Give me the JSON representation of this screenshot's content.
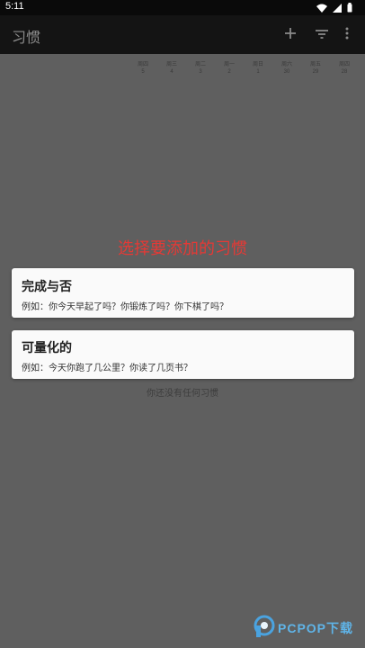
{
  "status": {
    "time": "5:11"
  },
  "appbar": {
    "title": "习惯",
    "icons": [
      "plus-icon",
      "filter-icon",
      "more-vert-icon"
    ]
  },
  "days": [
    {
      "name": "周四",
      "num": "5"
    },
    {
      "name": "周三",
      "num": "4"
    },
    {
      "name": "周二",
      "num": "3"
    },
    {
      "name": "周一",
      "num": "2"
    },
    {
      "name": "周日",
      "num": "1"
    },
    {
      "name": "周六",
      "num": "30"
    },
    {
      "name": "周五",
      "num": "29"
    },
    {
      "name": "周四",
      "num": "28"
    }
  ],
  "dialog": {
    "prompt": "选择要添加的习惯",
    "options": [
      {
        "title": "完成与否",
        "desc": "例如：你今天早起了吗？你锻炼了吗？你下棋了吗？"
      },
      {
        "title": "可量化的",
        "desc": "例如：今天你跑了几公里？你读了几页书？"
      }
    ]
  },
  "empty_text": "你还没有任何习惯",
  "watermark": {
    "text": "PCPOP下载"
  },
  "colors": {
    "prompt": "#e53935",
    "card": "#fafafa",
    "overlay": "#5f5f5f",
    "appbar": "#141414"
  }
}
